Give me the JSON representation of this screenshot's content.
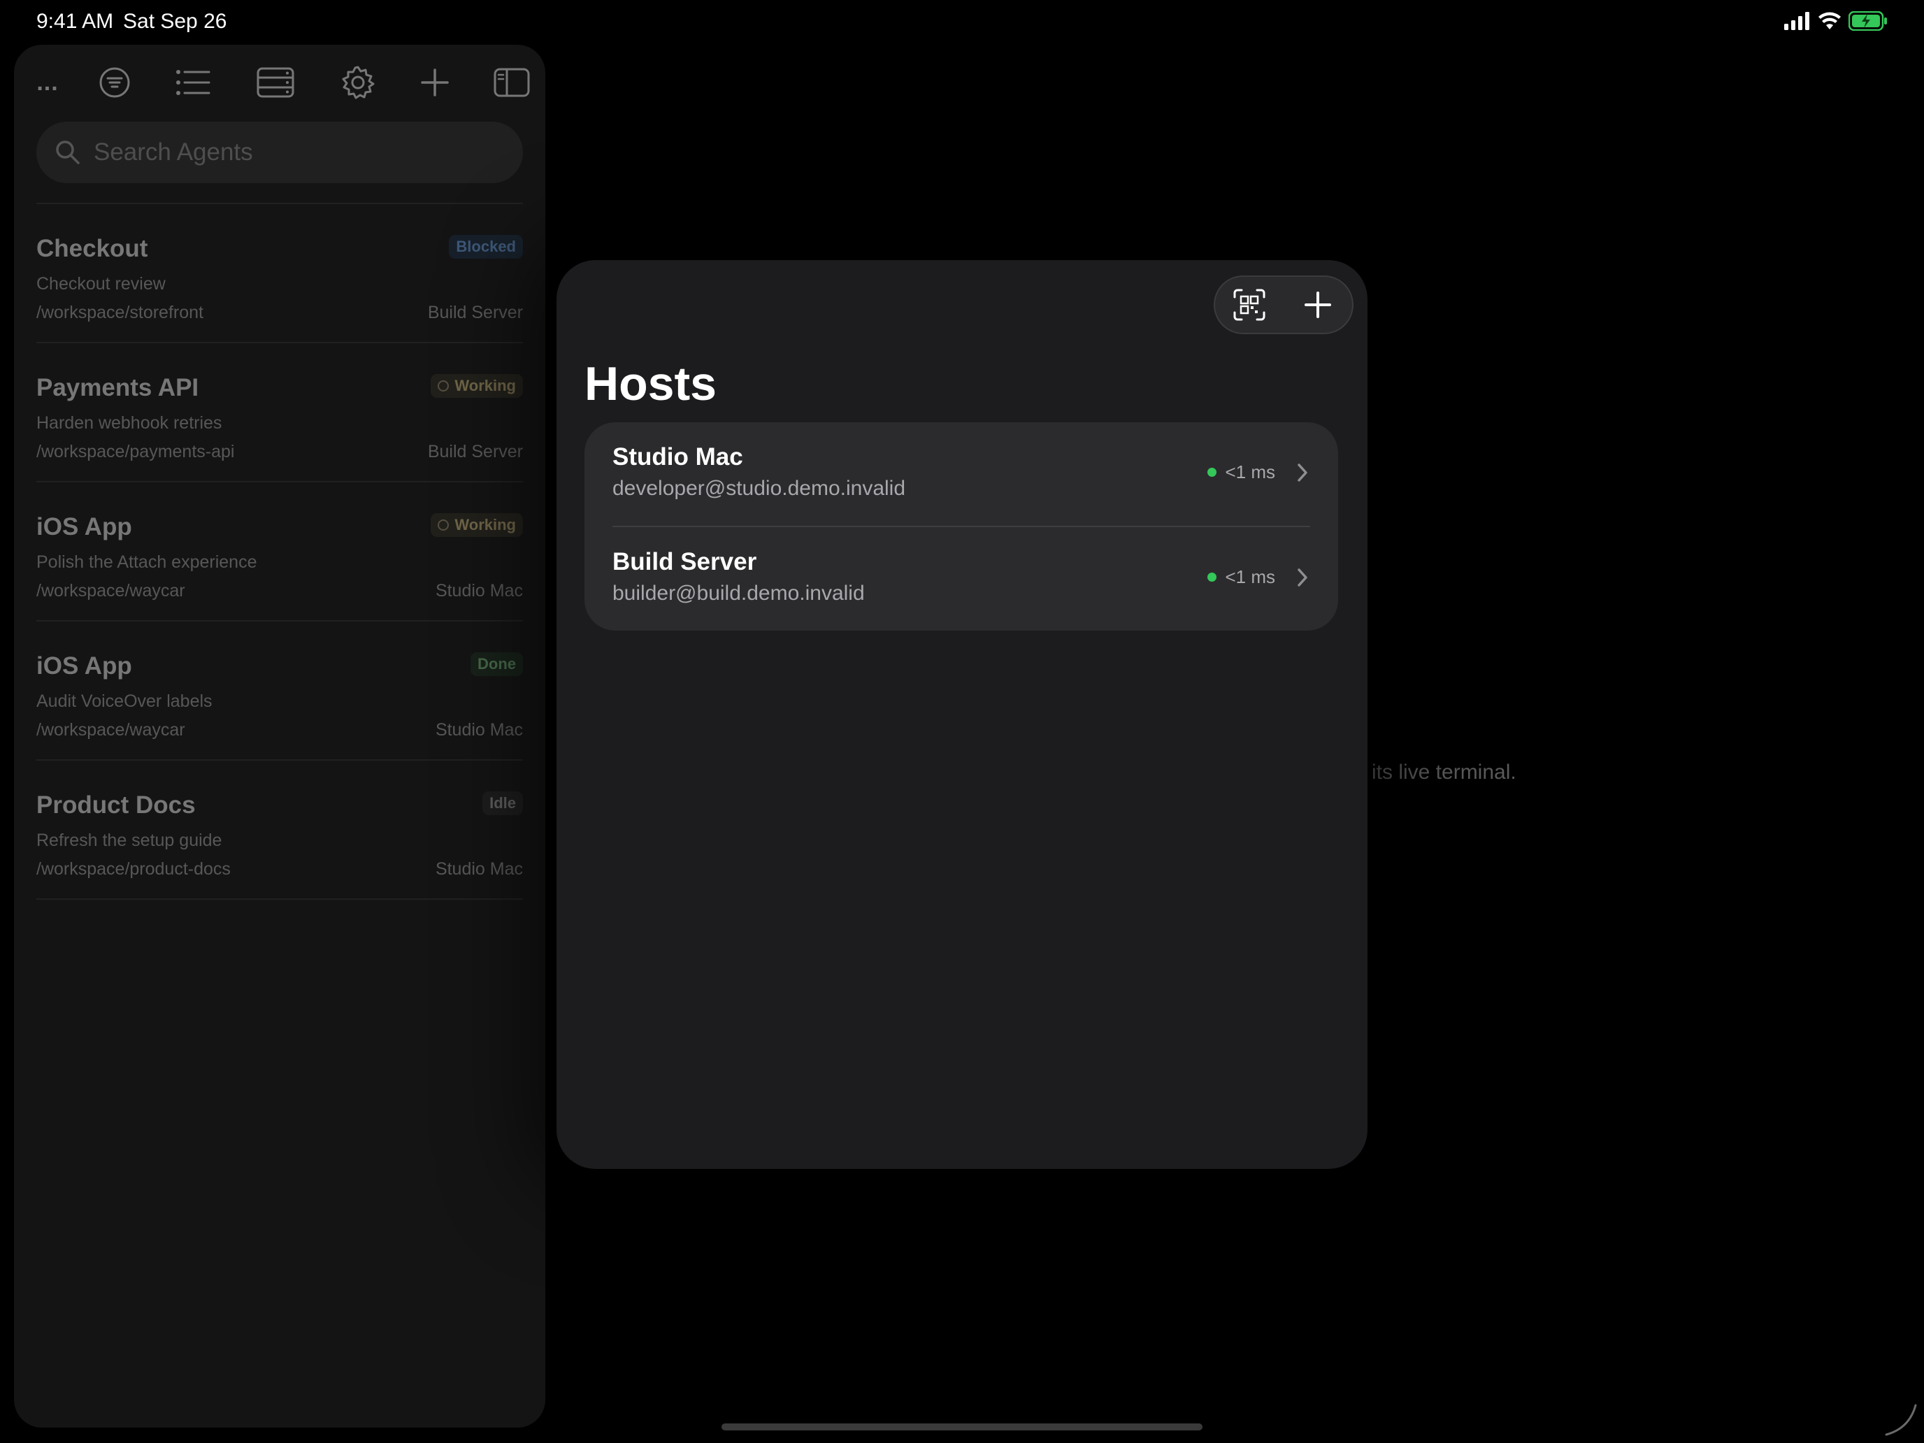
{
  "status_bar": {
    "time": "9:41 AM",
    "date": "Sat Sep 26"
  },
  "sidebar": {
    "toolbar_icons": [
      "more-icon",
      "filter-icon",
      "list-icon",
      "server-icon",
      "gear-icon",
      "plus-icon",
      "sidebar-toggle-icon"
    ],
    "more_label": "...",
    "search": {
      "placeholder": "Search Agents"
    },
    "agents": [
      {
        "title": "Checkout",
        "task": "Checkout review",
        "path": "/workspace/storefront",
        "host": "Build Server",
        "status": "Blocked"
      },
      {
        "title": "Payments API",
        "task": "Harden webhook retries",
        "path": "/workspace/payments-api",
        "host": "Build Server",
        "status": "Working"
      },
      {
        "title": "iOS App",
        "task": "Polish the Attach experience",
        "path": "/workspace/waycar",
        "host": "Studio Mac",
        "status": "Working"
      },
      {
        "title": "iOS App",
        "task": "Audit VoiceOver labels",
        "path": "/workspace/waycar",
        "host": "Studio Mac",
        "status": "Done"
      },
      {
        "title": "Product Docs",
        "task": "Refresh the setup guide",
        "path": "/workspace/product-docs",
        "host": "Studio Mac",
        "status": "Idle"
      }
    ]
  },
  "detail": {
    "hint_text": "its live terminal."
  },
  "hosts_sheet": {
    "title": "Hosts",
    "actions": [
      "qr-scan-icon",
      "plus-icon"
    ],
    "hosts": [
      {
        "name": "Studio Mac",
        "address": "developer@studio.demo.invalid",
        "latency": "<1 ms",
        "status_color": "#34c759"
      },
      {
        "name": "Build Server",
        "address": "builder@build.demo.invalid",
        "latency": "<1 ms",
        "status_color": "#34c759"
      }
    ]
  },
  "colors": {
    "accent_green": "#34c759",
    "blocked": "#5f8fc8",
    "working": "#b9a672",
    "done": "#6fae73",
    "idle": "#9a9a9a"
  }
}
